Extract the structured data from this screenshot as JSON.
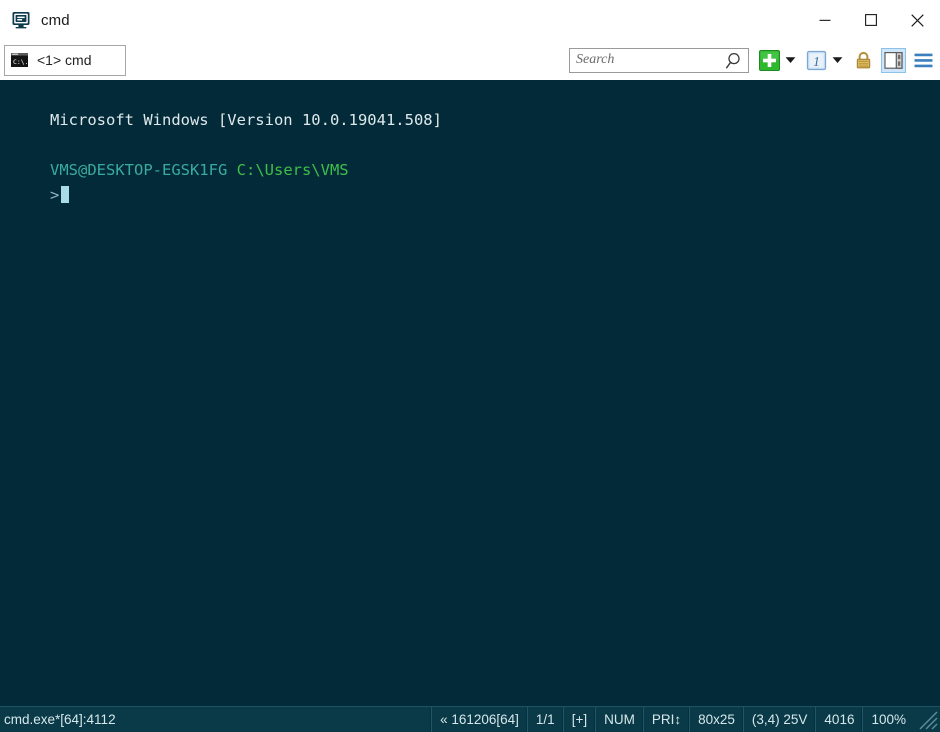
{
  "window": {
    "title": "cmd",
    "icon": "console-window-icon",
    "controls": {
      "minimize": "minimize-icon",
      "maximize": "maximize-icon",
      "close": "close-icon"
    }
  },
  "tabs": [
    {
      "label": "<1> cmd",
      "icon": "cmd-console-icon",
      "active": true
    }
  ],
  "toolbar": {
    "search": {
      "placeholder": "Search",
      "value": "",
      "icon": "magnifier-icon"
    },
    "buttons": [
      {
        "name": "new-console-button",
        "icon": "green-plus-icon",
        "label": ""
      },
      {
        "name": "new-console-dropdown",
        "icon": "chevron-down-icon",
        "label": ""
      },
      {
        "name": "active-console-button",
        "icon": "numbered-window-1-icon",
        "label": "1"
      },
      {
        "name": "active-console-dropdown",
        "icon": "chevron-down-icon",
        "label": ""
      },
      {
        "name": "lock-button",
        "icon": "padlock-icon",
        "label": ""
      },
      {
        "name": "split-pane-button",
        "icon": "split-pane-icon",
        "label": "",
        "active": true
      },
      {
        "name": "menu-button",
        "icon": "hamburger-menu-icon",
        "label": ""
      }
    ]
  },
  "terminal": {
    "background": "#022a38",
    "lines": [
      {
        "segments": [
          {
            "text": "Microsoft Windows [Version 10.0.19041.508]",
            "color": "#dfe9ec"
          }
        ]
      },
      {
        "segments": []
      },
      {
        "segments": [
          {
            "text": "VMS@DESKTOP-EGSK1FG",
            "color": "#3aab9c"
          },
          {
            "text": " ",
            "color": "#dfe9ec"
          },
          {
            "text": "C:\\Users\\VMS",
            "color": "#3fbf4a"
          }
        ]
      },
      {
        "segments": [
          {
            "text": ">",
            "color": "#8fb4bd"
          }
        ],
        "cursor": true
      }
    ]
  },
  "statusbar": {
    "process": "cmd.exe*[64]:4112",
    "fields": [
      {
        "name": "build",
        "text": "« 161206[64]"
      },
      {
        "name": "console-index",
        "text": "1/1"
      },
      {
        "name": "scroll-state",
        "text": "[+]"
      },
      {
        "name": "num-lock",
        "text": "NUM"
      },
      {
        "name": "priority",
        "text": "PRI↕"
      },
      {
        "name": "buffer-size",
        "text": "80x25"
      },
      {
        "name": "cursor-position",
        "text": "(3,4) 25V"
      },
      {
        "name": "memory",
        "text": "4016"
      },
      {
        "name": "zoom",
        "text": "100%"
      }
    ]
  },
  "colors": {
    "terminal_bg": "#022a38",
    "status_bg": "#0a3a47",
    "accent_green": "#3fbf4a",
    "accent_cyan": "#3aab9c",
    "active_highlight": "#cfe6fa"
  }
}
